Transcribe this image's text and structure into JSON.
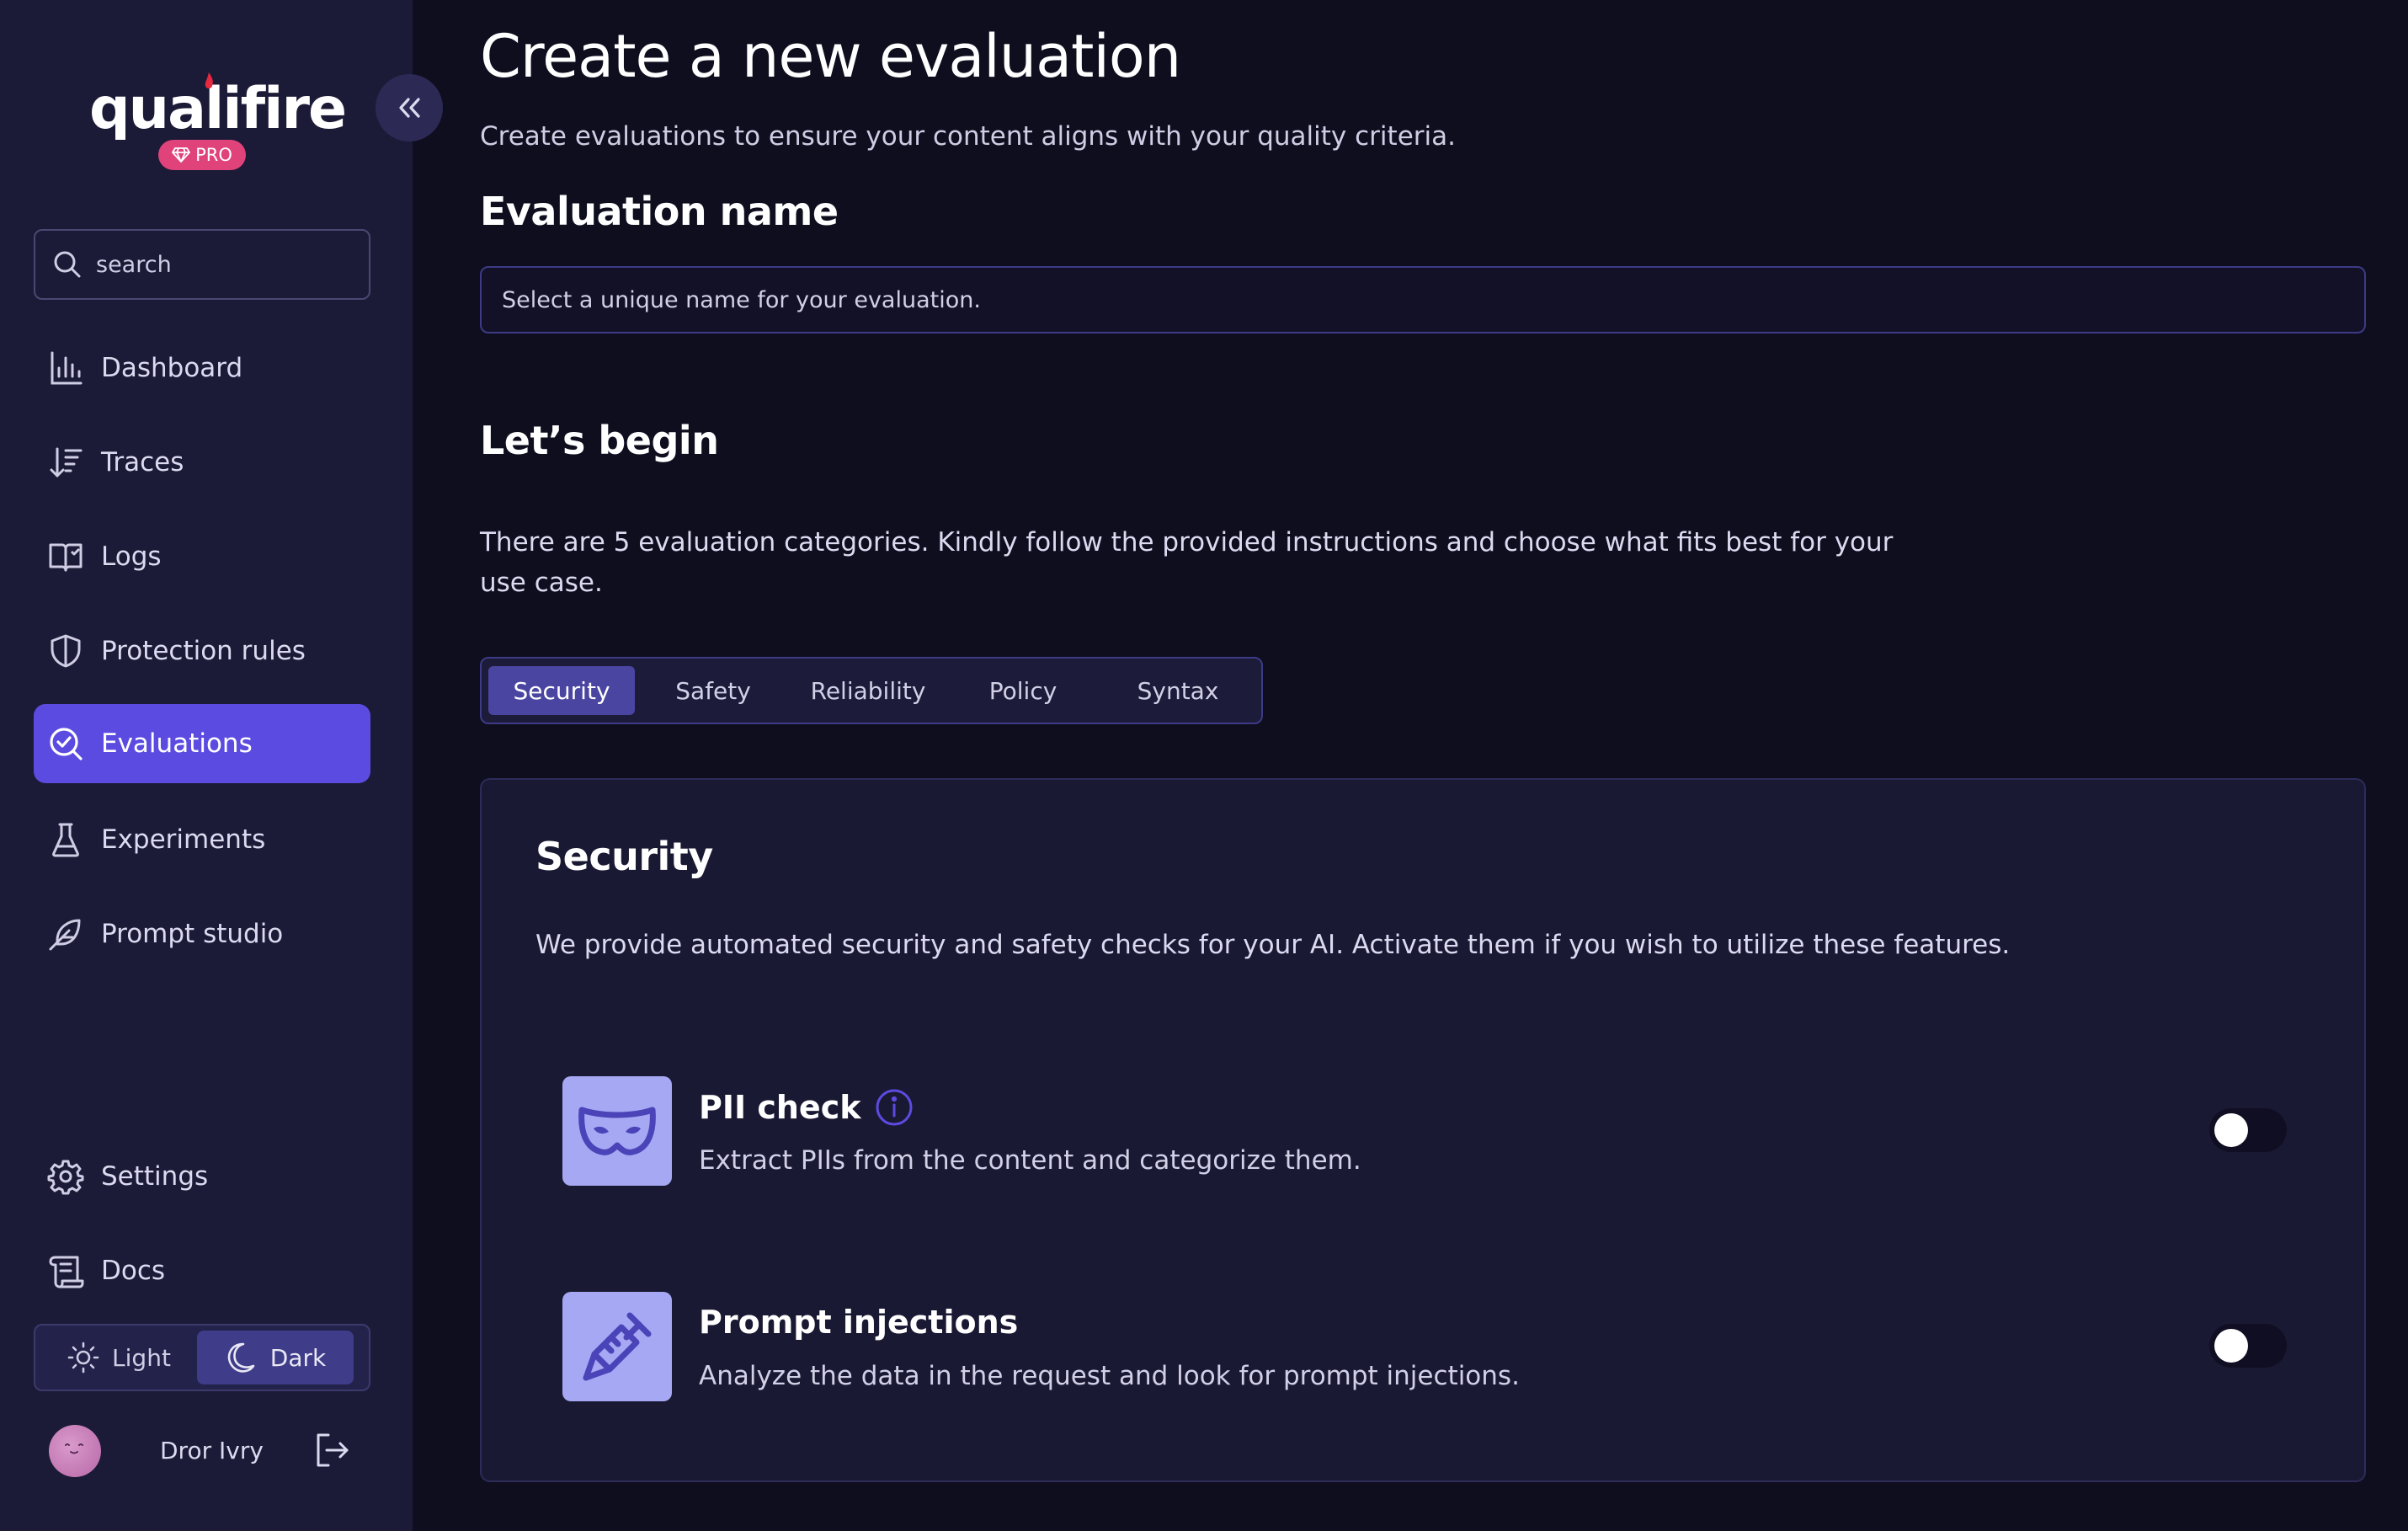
{
  "brand": {
    "name": "qualifire",
    "plan_badge": "PRO",
    "accent_color": "#5b4be0",
    "badge_color": "#e0427a"
  },
  "sidebar": {
    "search_placeholder": "search",
    "nav": [
      {
        "label": "Dashboard",
        "icon": "bar-chart-icon",
        "active": false
      },
      {
        "label": "Traces",
        "icon": "sort-arrow-icon",
        "active": false
      },
      {
        "label": "Logs",
        "icon": "book-icon",
        "active": false
      },
      {
        "label": "Protection rules",
        "icon": "shield-icon",
        "active": false
      },
      {
        "label": "Evaluations",
        "icon": "search-check-icon",
        "active": true
      },
      {
        "label": "Experiments",
        "icon": "flask-icon",
        "active": false
      },
      {
        "label": "Prompt studio",
        "icon": "feather-icon",
        "active": false
      }
    ],
    "bottom_nav": [
      {
        "label": "Settings",
        "icon": "gear-icon"
      },
      {
        "label": "Docs",
        "icon": "scroll-icon"
      }
    ],
    "theme": {
      "light_label": "Light",
      "dark_label": "Dark",
      "selected": "Dark"
    },
    "user": {
      "name": "Dror Ivry"
    }
  },
  "main": {
    "title": "Create a new evaluation",
    "subtitle": "Create evaluations to ensure your content aligns with your quality criteria.",
    "name_section": {
      "heading": "Evaluation name",
      "placeholder": "Select a unique name for your evaluation."
    },
    "begin_section": {
      "heading": "Let’s begin",
      "intro": "There are 5 evaluation categories. Kindly follow the provided instructions and choose what fits best for your use case."
    },
    "tabs": [
      {
        "label": "Security",
        "active": true
      },
      {
        "label": "Safety",
        "active": false
      },
      {
        "label": "Reliability",
        "active": false
      },
      {
        "label": "Policy",
        "active": false
      },
      {
        "label": "Syntax",
        "active": false
      }
    ],
    "card": {
      "title": "Security",
      "description": "We provide automated security and safety checks for your AI. Activate them if you wish to utilize these features.",
      "features": [
        {
          "name": "PII check",
          "description": "Extract PIIs from the content and categorize them.",
          "icon": "mask-icon",
          "enabled": false,
          "has_info": true
        },
        {
          "name": "Prompt injections",
          "description": "Analyze the data in the request and look for prompt injections.",
          "icon": "syringe-icon",
          "enabled": false,
          "has_info": false
        }
      ]
    }
  }
}
